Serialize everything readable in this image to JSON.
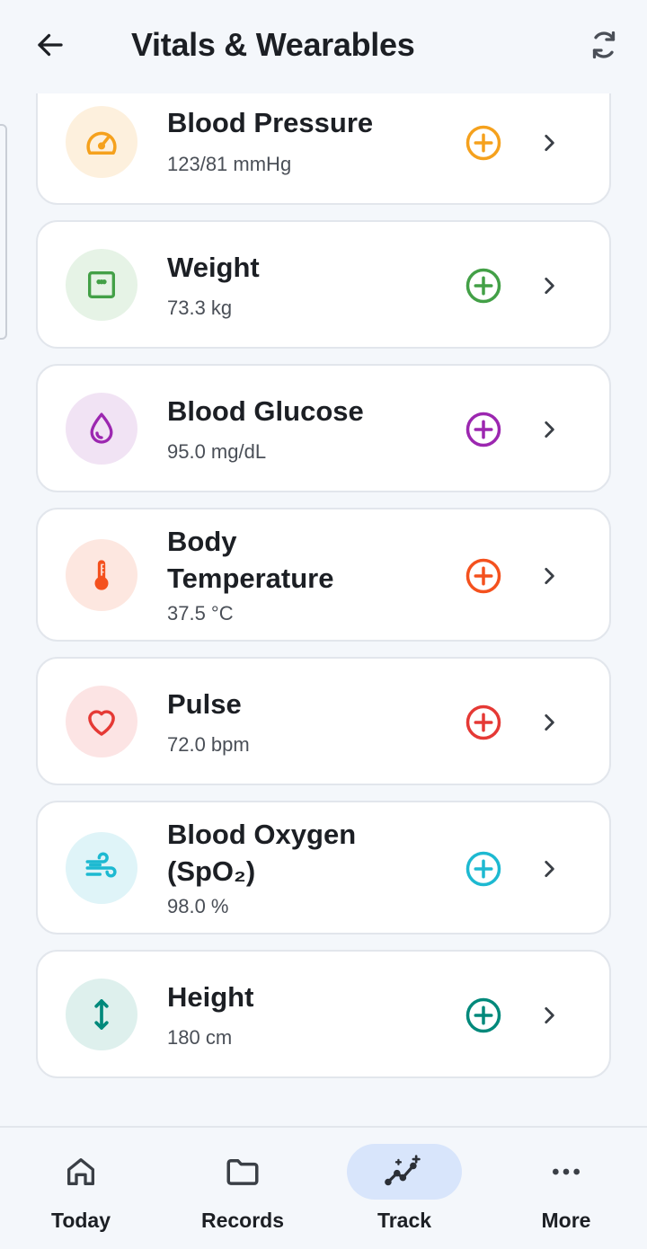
{
  "header": {
    "title": "Vitals & Wearables",
    "back_icon": "arrow-left-icon",
    "sync_icon": "sync-icon"
  },
  "vitals": [
    {
      "name": "Blood Pressure",
      "value": "123/81 mmHg",
      "icon": "gauge-icon",
      "color": "#f5a11d",
      "bg": "#fdf0dd"
    },
    {
      "name": "Weight",
      "value": "73.3 kg",
      "icon": "scale-icon",
      "color": "#43a047",
      "bg": "#e6f3e6"
    },
    {
      "name": "Blood Glucose",
      "value": "95.0 mg/dL",
      "icon": "drop-icon",
      "color": "#9c27b0",
      "bg": "#f1e3f4"
    },
    {
      "name": "Body Temperature",
      "value": "37.5 °C",
      "icon": "thermometer-icon",
      "color": "#f4511e",
      "bg": "#fde7e0"
    },
    {
      "name": "Pulse",
      "value": "72.0 bpm",
      "icon": "heart-icon",
      "color": "#e53935",
      "bg": "#fce4e4"
    },
    {
      "name": "Blood Oxygen (SpO₂)",
      "value": "98.0 %",
      "icon": "wind-icon",
      "color": "#1db9d1",
      "bg": "#dff4f8"
    },
    {
      "name": "Height",
      "value": "180 cm",
      "icon": "height-arrows-icon",
      "color": "#00897b",
      "bg": "#def0ed"
    }
  ],
  "nav": [
    {
      "label": "Today",
      "icon": "home-icon",
      "active": false
    },
    {
      "label": "Records",
      "icon": "folder-icon",
      "active": false
    },
    {
      "label": "Track",
      "icon": "sparkle-chart-icon",
      "active": true
    },
    {
      "label": "More",
      "icon": "more-dots-icon",
      "active": false
    }
  ]
}
